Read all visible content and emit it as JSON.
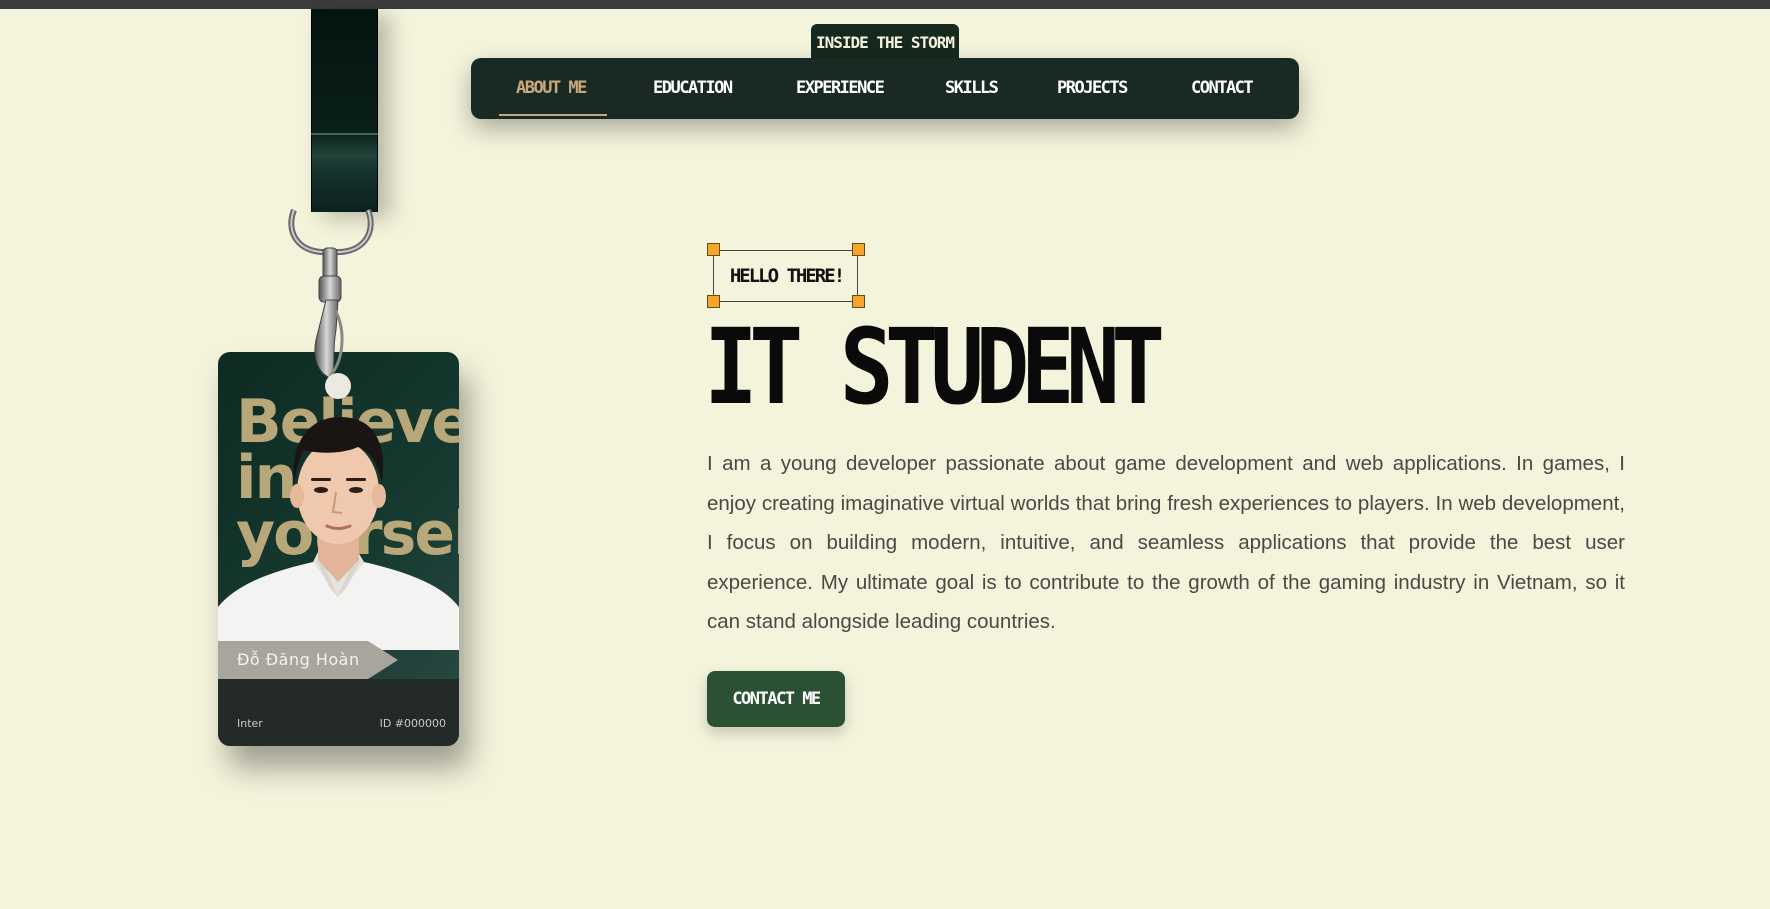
{
  "nav": {
    "brand": "INSIDE THE STORM",
    "items": [
      {
        "label": "ABOUT ME",
        "active": true
      },
      {
        "label": "EDUCATION",
        "active": false
      },
      {
        "label": "EXPERIENCE",
        "active": false
      },
      {
        "label": "SKILLS",
        "active": false
      },
      {
        "label": "PROJECTS",
        "active": false
      },
      {
        "label": "CONTACT",
        "active": false
      }
    ]
  },
  "id_card": {
    "background_text": [
      "Believe",
      "in",
      "yourself"
    ],
    "name": "Đỗ Đăng Hoàn",
    "footer_left": "Inter",
    "footer_right": "ID #000000"
  },
  "hero": {
    "tag": "HELLO THERE!",
    "title": "IT STUDENT",
    "description": "I am a young developer passionate about game development and web applications. In games, I enjoy creating imaginative virtual worlds that bring fresh experiences to players. In web development, I focus on building modern, intuitive, and seamless applications that provide the best user experience. My ultimate goal is to contribute to the growth of the gaming industry in Vietnam, so it can stand alongside leading countries.",
    "cta_label": "CONTACT ME"
  },
  "colors": {
    "background": "#f4f4dd",
    "nav_bg": "#192a24",
    "accent": "#c9a87a",
    "button": "#295132",
    "selection_handle": "#f4a62a"
  }
}
